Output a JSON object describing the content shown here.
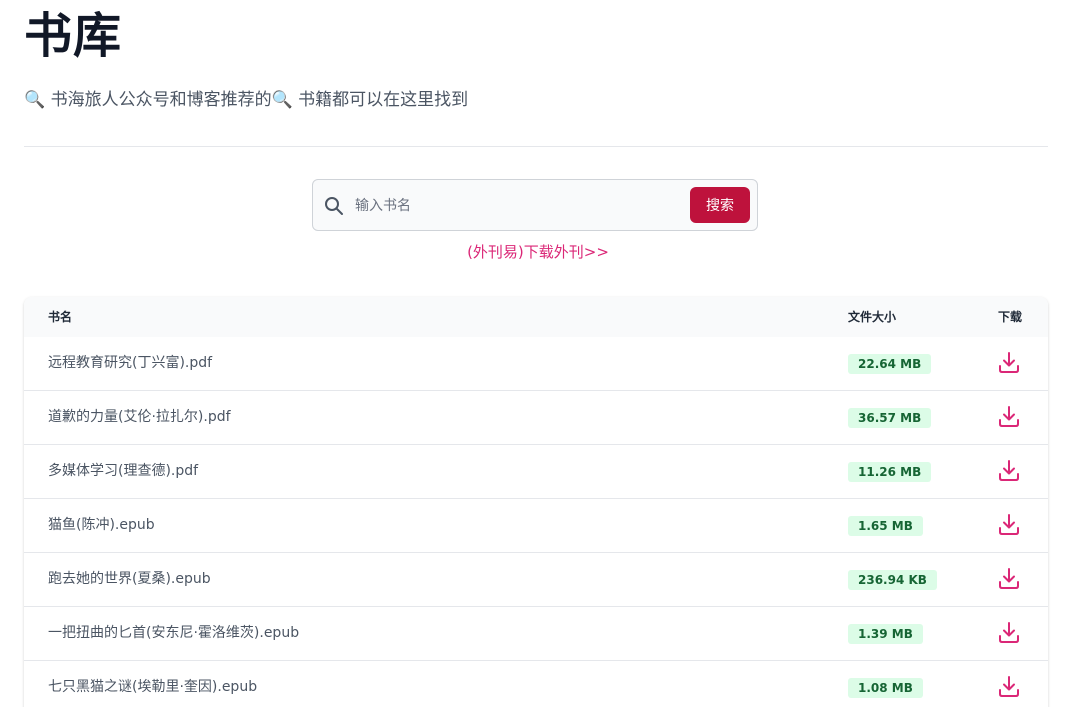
{
  "header": {
    "title": "书库",
    "subtitle": "🔍 书海旅人公众号和博客推荐的🔍 书籍都可以在这里找到"
  },
  "search": {
    "placeholder": "输入书名",
    "value": "",
    "button_label": "搜索"
  },
  "promo": {
    "link_text": "(外刊易)下载外刊>>"
  },
  "table": {
    "columns": {
      "name": "书名",
      "size": "文件大小",
      "download": "下载"
    },
    "rows": [
      {
        "name": "远程教育研究(丁兴富).pdf",
        "size": "22.64 MB"
      },
      {
        "name": "道歉的力量(艾伦·拉扎尔).pdf",
        "size": "36.57 MB"
      },
      {
        "name": "多媒体学习(理查德).pdf",
        "size": "11.26 MB"
      },
      {
        "name": "猫鱼(陈冲).epub",
        "size": "1.65 MB"
      },
      {
        "name": "跑去她的世界(夏桑).epub",
        "size": "236.94 KB"
      },
      {
        "name": "一把扭曲的匕首(安东尼·霍洛维茨).epub",
        "size": "1.39 MB"
      },
      {
        "name": "七只黑猫之谜(埃勒里·奎因).epub",
        "size": "1.08 MB"
      }
    ]
  },
  "icons": {
    "search": "search-icon",
    "download": "download-icon"
  },
  "colors": {
    "accent": "#be123c",
    "link": "#db2777",
    "badge_bg": "#dcfce7",
    "badge_text": "#166534"
  }
}
